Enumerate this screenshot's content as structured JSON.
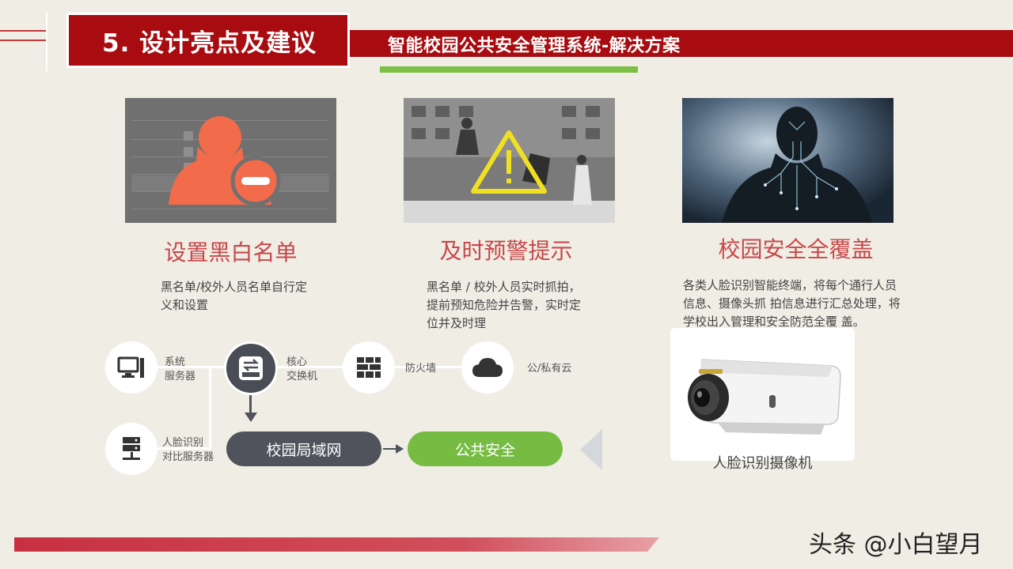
{
  "header": {
    "title": "5. 设计亮点及建议",
    "subtitle": "智能校园公共安全管理系统-解决方案"
  },
  "features": [
    {
      "title": "设置黑白名单",
      "desc_lines": [
        "黑名单/校外人员名单自行定",
        "义和设置"
      ]
    },
    {
      "title": "及时预警提示",
      "desc_lines": [
        "黑名单 / 校外人员实时抓拍，",
        "提前预知危险并告警，实时定",
        "位并及时理"
      ]
    },
    {
      "title": "校园安全全覆盖",
      "desc_lines": [
        "各类人脸识别智能终端，将每个通行人员",
        "信息、摄像头抓  拍信息进行汇总处理，将",
        "学校出入管理和安全防范全覆  盖。"
      ]
    }
  ],
  "network": {
    "server": [
      "系统",
      "服务器"
    ],
    "switch": [
      "核心",
      "交换机"
    ],
    "firewall": "防火墙",
    "cloud": "公/私有云",
    "face_server": [
      "人脸识别",
      "对比服务器"
    ],
    "lan": "校园局域网",
    "public_safety": "公共安全"
  },
  "camera_label": "人脸识别摄像机",
  "watermark": "头条 @小白望月",
  "colors": {
    "brand_red": "#a80c10",
    "accent_green": "#76bc43",
    "feature_red": "#c8474a",
    "orange_person": "#f26b4a",
    "warning_yellow": "#f0e021"
  }
}
